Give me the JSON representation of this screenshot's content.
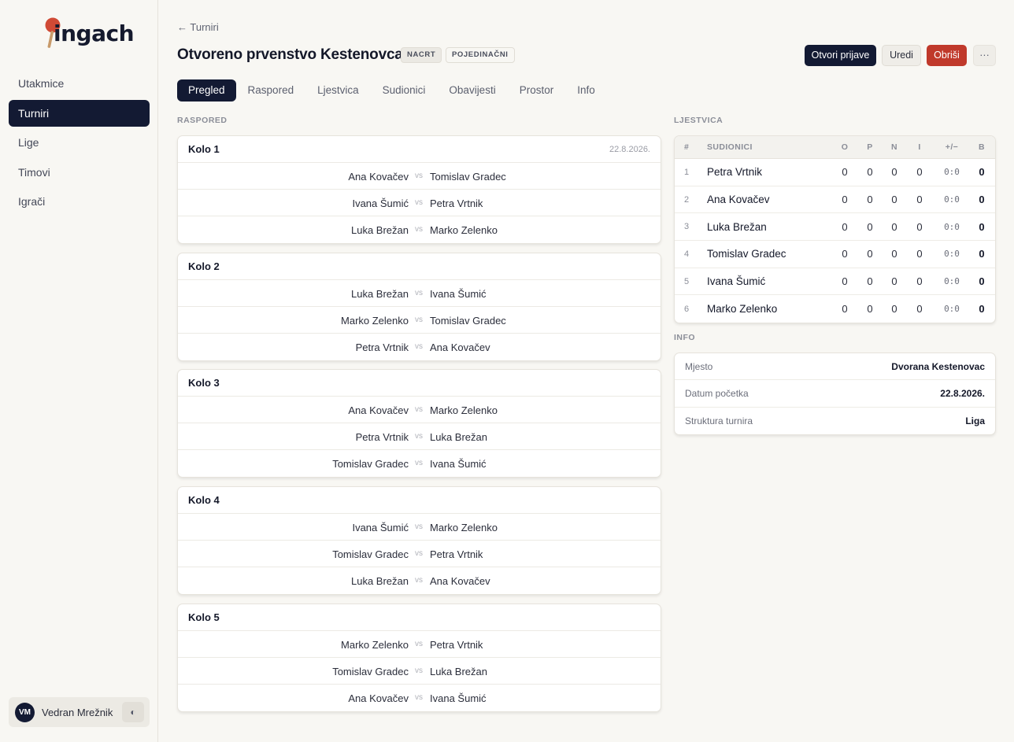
{
  "app": {
    "name": "ingach",
    "accent": "#131a33",
    "danger": "#c0392b"
  },
  "sidebar": {
    "items": [
      {
        "label": "Utakmice"
      },
      {
        "label": "Turniri"
      },
      {
        "label": "Lige"
      },
      {
        "label": "Timovi"
      },
      {
        "label": "Igrači"
      }
    ],
    "active": "Turniri",
    "user": {
      "initials": "VM",
      "name": "Vedran Mrežnik"
    },
    "theme_icon": "◐"
  },
  "header": {
    "back_label": "← Turniri",
    "title": "Otvoreno prvenstvo Kestenovca",
    "badges": {
      "status": "NACRT",
      "type": "POJEDINAČNI"
    },
    "actions": {
      "open": "Otvori prijave",
      "edit": "Uredi",
      "delete": "Obriši",
      "more": "···"
    }
  },
  "tabs": [
    "Pregled",
    "Raspored",
    "Ljestvica",
    "Sudionici",
    "Obavijesti",
    "Prostor",
    "Info"
  ],
  "schedule": {
    "label": "RASPORED",
    "vs": "vs",
    "rounds": [
      {
        "title": "Kolo 1",
        "date": "22.8.2026.",
        "matches": [
          {
            "home": "Ana Kovačev",
            "away": "Tomislav Gradec"
          },
          {
            "home": "Ivana Šumić",
            "away": "Petra Vrtnik"
          },
          {
            "home": "Luka Brežan",
            "away": "Marko Zelenko"
          }
        ]
      },
      {
        "title": "Kolo 2",
        "date": "",
        "matches": [
          {
            "home": "Luka Brežan",
            "away": "Ivana Šumić"
          },
          {
            "home": "Marko Zelenko",
            "away": "Tomislav Gradec"
          },
          {
            "home": "Petra Vrtnik",
            "away": "Ana Kovačev"
          }
        ]
      },
      {
        "title": "Kolo 3",
        "date": "",
        "matches": [
          {
            "home": "Ana Kovačev",
            "away": "Marko Zelenko"
          },
          {
            "home": "Petra Vrtnik",
            "away": "Luka Brežan"
          },
          {
            "home": "Tomislav Gradec",
            "away": "Ivana Šumić"
          }
        ]
      },
      {
        "title": "Kolo 4",
        "date": "",
        "matches": [
          {
            "home": "Ivana Šumić",
            "away": "Marko Zelenko"
          },
          {
            "home": "Tomislav Gradec",
            "away": "Petra Vrtnik"
          },
          {
            "home": "Luka Brežan",
            "away": "Ana Kovačev"
          }
        ]
      },
      {
        "title": "Kolo 5",
        "date": "",
        "matches": [
          {
            "home": "Marko Zelenko",
            "away": "Petra Vrtnik"
          },
          {
            "home": "Tomislav Gradec",
            "away": "Luka Brežan"
          },
          {
            "home": "Ana Kovačev",
            "away": "Ivana Šumić"
          }
        ]
      }
    ]
  },
  "standings": {
    "label": "LJESTVICA",
    "columns": {
      "rank": "#",
      "name": "SUDIONICI",
      "o": "O",
      "p": "P",
      "n": "N",
      "i": "I",
      "diff": "+/−",
      "b": "B"
    },
    "rows": [
      {
        "rank": "1",
        "name": "Petra Vrtnik",
        "o": "0",
        "p": "0",
        "n": "0",
        "i": "0",
        "diff": "0:0",
        "b": "0"
      },
      {
        "rank": "2",
        "name": "Ana Kovačev",
        "o": "0",
        "p": "0",
        "n": "0",
        "i": "0",
        "diff": "0:0",
        "b": "0"
      },
      {
        "rank": "3",
        "name": "Luka Brežan",
        "o": "0",
        "p": "0",
        "n": "0",
        "i": "0",
        "diff": "0:0",
        "b": "0"
      },
      {
        "rank": "4",
        "name": "Tomislav Gradec",
        "o": "0",
        "p": "0",
        "n": "0",
        "i": "0",
        "diff": "0:0",
        "b": "0"
      },
      {
        "rank": "5",
        "name": "Ivana Šumić",
        "o": "0",
        "p": "0",
        "n": "0",
        "i": "0",
        "diff": "0:0",
        "b": "0"
      },
      {
        "rank": "6",
        "name": "Marko Zelenko",
        "o": "0",
        "p": "0",
        "n": "0",
        "i": "0",
        "diff": "0:0",
        "b": "0"
      }
    ]
  },
  "info": {
    "label": "INFO",
    "rows": [
      {
        "key": "Mjesto",
        "value": "Dvorana Kestenovac"
      },
      {
        "key": "Datum početka",
        "value": "22.8.2026."
      },
      {
        "key": "Struktura turnira",
        "value": "Liga"
      }
    ]
  }
}
